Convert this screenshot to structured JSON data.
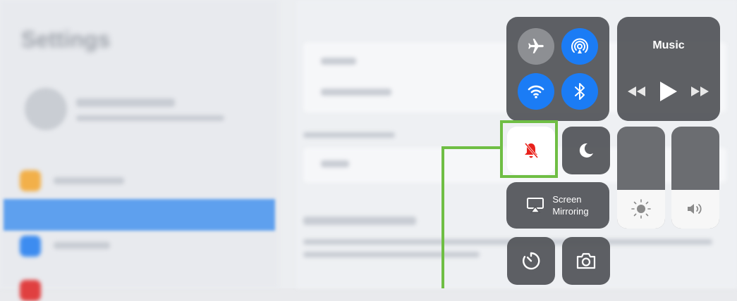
{
  "background_app": {
    "title": "Settings"
  },
  "control_center": {
    "connectivity": {
      "airplane_mode": {
        "icon": "airplane-icon",
        "state": "off"
      },
      "airdrop": {
        "icon": "airdrop-icon",
        "state": "on"
      },
      "wifi": {
        "icon": "wifi-icon",
        "state": "on"
      },
      "bluetooth": {
        "icon": "bluetooth-icon",
        "state": "on"
      }
    },
    "music": {
      "title": "Music",
      "controls": [
        "rewind-icon",
        "play-icon",
        "fast-forward-icon"
      ]
    },
    "silent_mode": {
      "icon": "bell-slash-icon",
      "state": "on",
      "highlighted": true
    },
    "do_not_disturb": {
      "icon": "moon-icon",
      "state": "off"
    },
    "screen_mirroring": {
      "line1": "Screen",
      "line2": "Mirroring",
      "icon": "airplay-icon"
    },
    "brightness": {
      "icon": "sun-icon",
      "level": 0.38
    },
    "volume": {
      "icon": "speaker-icon",
      "level": 0.38
    },
    "timer": {
      "icon": "timer-icon"
    },
    "camera": {
      "icon": "camera-icon"
    }
  },
  "colors": {
    "active_blue": "#1b7cf5",
    "inactive_gray": "#8d8f93",
    "tile_bg": "#525458",
    "silent_red": "#e8221c",
    "highlight_green": "#6fbe44"
  }
}
